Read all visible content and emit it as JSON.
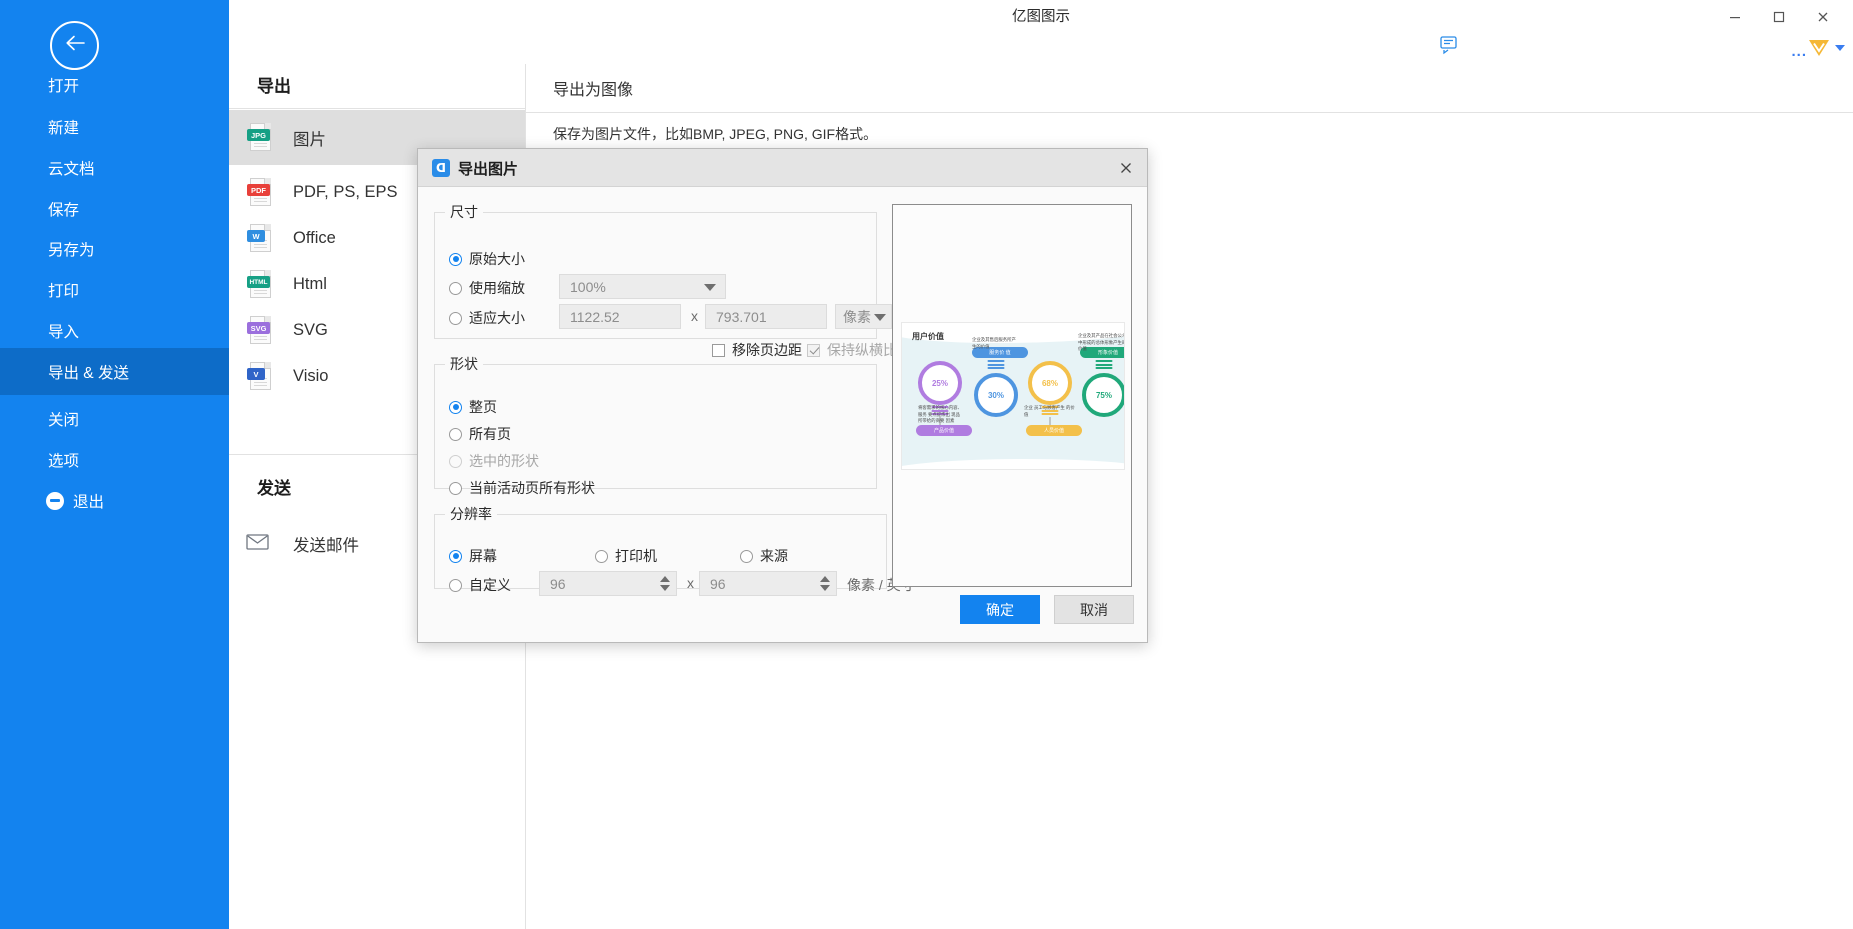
{
  "window": {
    "title": "亿图图示",
    "minimize": "minimize-icon",
    "maximize": "maximize-icon",
    "close": "close-icon"
  },
  "toolbar": {
    "chat_icon": "chat-icon",
    "more_dots": "...",
    "account_icon": "diamond-icon"
  },
  "sidebar": {
    "back_icon": "arrow-left-icon",
    "items": [
      {
        "label": "打开",
        "active": false
      },
      {
        "label": "新建",
        "active": false
      },
      {
        "label": "云文档",
        "active": false
      },
      {
        "label": "保存",
        "active": false
      },
      {
        "label": "另存为",
        "active": false
      },
      {
        "label": "打印",
        "active": false
      },
      {
        "label": "导入",
        "active": false
      },
      {
        "label": "导出 & 发送",
        "active": true
      },
      {
        "label": "关闭",
        "active": false
      },
      {
        "label": "选项",
        "active": false
      }
    ],
    "exit": {
      "label": "退出",
      "icon": "minus-circle-icon"
    }
  },
  "export_panel": {
    "section_export_title": "导出",
    "section_send_title": "发送",
    "formats": [
      {
        "label": "图片",
        "badge": "JPG",
        "color": "#16a085",
        "selected": true
      },
      {
        "label": "PDF, PS, EPS",
        "badge": "PDF",
        "color": "#e8403a",
        "selected": false
      },
      {
        "label": "Office",
        "badge": "W",
        "color": "#2f8ee0",
        "selected": false
      },
      {
        "label": "Html",
        "badge": "HTML",
        "color": "#16a085",
        "selected": false
      },
      {
        "label": "SVG",
        "badge": "SVG",
        "color": "#9b6fdd",
        "selected": false
      },
      {
        "label": "Visio",
        "badge": "V",
        "color": "#2f64c8",
        "selected": false
      }
    ],
    "send_items": [
      {
        "label": "发送邮件",
        "icon": "mail-icon"
      }
    ]
  },
  "content": {
    "title": "导出为图像",
    "description": "保存为图片文件，比如BMP, JPEG, PNG, GIF格式。"
  },
  "dialog": {
    "title": "导出图片",
    "brand_icon": "eddx-logo-icon",
    "close_icon": "close-icon",
    "size": {
      "legend": "尺寸",
      "original": {
        "label": "原始大小",
        "selected": true
      },
      "scale": {
        "label": "使用缩放",
        "selected": false,
        "value": "100%"
      },
      "fit": {
        "label": "适应大小",
        "selected": false,
        "width": "1122.52",
        "height": "793.701",
        "separator": "x",
        "unit": "像素"
      },
      "remove_margin": {
        "label": "移除页边距",
        "checked": false,
        "disabled": false
      },
      "keep_ratio": {
        "label": "保持纵横比",
        "checked": true,
        "disabled": true
      }
    },
    "shape": {
      "legend": "形状",
      "options": [
        {
          "label": "整页",
          "selected": true,
          "disabled": false
        },
        {
          "label": "所有页",
          "selected": false,
          "disabled": false
        },
        {
          "label": "选中的形状",
          "selected": false,
          "disabled": true
        },
        {
          "label": "当前活动页所有形状",
          "selected": false,
          "disabled": false
        }
      ]
    },
    "resolution": {
      "legend": "分辨率",
      "options": [
        {
          "label": "屏幕",
          "selected": true
        },
        {
          "label": "打印机",
          "selected": false
        },
        {
          "label": "来源",
          "selected": false
        }
      ],
      "custom": {
        "label": "自定义",
        "selected": false,
        "x_value": "96",
        "y_value": "96",
        "separator": "x",
        "unit": "像素 / 英寸"
      }
    },
    "buttons": {
      "ok": "确定",
      "cancel": "取消"
    },
    "preview": {
      "doc_title": "用户价值",
      "bulbs": [
        {
          "pct": "25%",
          "color": "#b07ce0",
          "pill": "产品价值",
          "caption": "将客需求的核心\n内容、服务 要点\n提炼出 现品所\n带给的商要 因素"
        },
        {
          "pct": "30%",
          "color": "#4e95e0",
          "pill": "服务价 值",
          "caption": "企业及其售后\n服务所产生的价\n值"
        },
        {
          "pct": "68%",
          "color": "#f3c04a",
          "pill": "人员价值",
          "caption": "企业 员工与顾客\n产生 的价值"
        },
        {
          "pct": "75%",
          "color": "#20a87a",
          "pill": "形象价值",
          "caption": "企业及其产品在\n社会公众中形成\n的总体形象产生\n的价值"
        }
      ]
    }
  }
}
